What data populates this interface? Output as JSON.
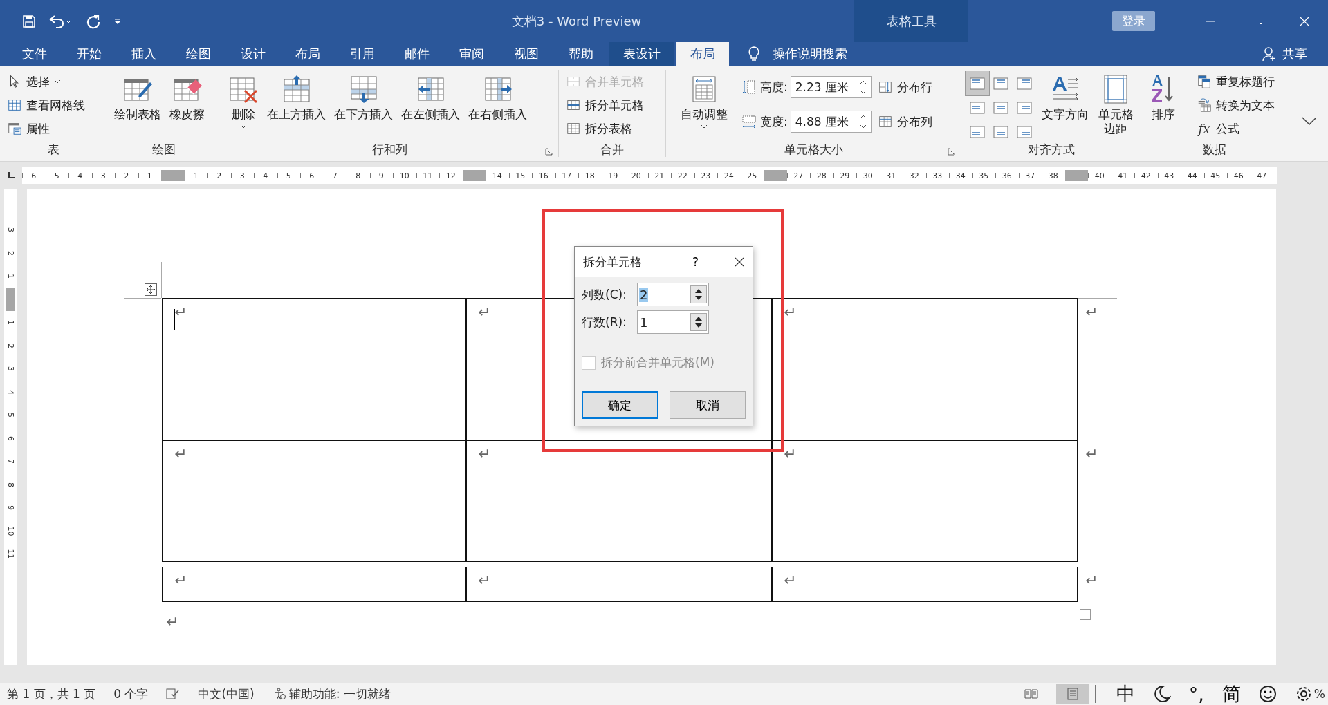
{
  "window": {
    "title": "文档3  -  Word Preview",
    "context_group": "表格工具",
    "signin": "登录"
  },
  "tabs": [
    {
      "label": "文件",
      "selected": false,
      "contextual": false
    },
    {
      "label": "开始",
      "selected": false,
      "contextual": false
    },
    {
      "label": "插入",
      "selected": false,
      "contextual": false
    },
    {
      "label": "绘图",
      "selected": false,
      "contextual": false
    },
    {
      "label": "设计",
      "selected": false,
      "contextual": false
    },
    {
      "label": "布局",
      "selected": false,
      "contextual": false
    },
    {
      "label": "引用",
      "selected": false,
      "contextual": false
    },
    {
      "label": "邮件",
      "selected": false,
      "contextual": false
    },
    {
      "label": "审阅",
      "selected": false,
      "contextual": false
    },
    {
      "label": "视图",
      "selected": false,
      "contextual": false
    },
    {
      "label": "帮助",
      "selected": false,
      "contextual": false
    },
    {
      "label": "表设计",
      "selected": false,
      "contextual": true
    },
    {
      "label": "布局",
      "selected": true,
      "contextual": true
    }
  ],
  "tell_me": "操作说明搜索",
  "share": "共享",
  "ribbon": {
    "groups": [
      {
        "label": "表",
        "launcher": false,
        "items": [
          {
            "kind": "small",
            "label": "选择",
            "dropdown": true
          },
          {
            "kind": "small",
            "label": "查看网格线"
          },
          {
            "kind": "small",
            "label": "属性"
          }
        ]
      },
      {
        "label": "绘图",
        "launcher": false,
        "items": [
          {
            "kind": "large",
            "label": "绘制表格"
          },
          {
            "kind": "large",
            "label": "橡皮擦"
          }
        ]
      },
      {
        "label": "行和列",
        "launcher": true,
        "items": [
          {
            "kind": "large",
            "label": "删除",
            "dropdown": true
          },
          {
            "kind": "large",
            "label": "在上方插入"
          },
          {
            "kind": "large",
            "label": "在下方插入"
          },
          {
            "kind": "large",
            "label": "在左侧插入"
          },
          {
            "kind": "large",
            "label": "在右侧插入"
          }
        ]
      },
      {
        "label": "合并",
        "launcher": false,
        "items": [
          {
            "kind": "small",
            "label": "合并单元格",
            "disabled": true
          },
          {
            "kind": "small",
            "label": "拆分单元格",
            "disabled": false
          },
          {
            "kind": "small",
            "label": "拆分表格",
            "disabled": false
          }
        ]
      },
      {
        "label": "单元格大小",
        "launcher": true,
        "items": [
          {
            "kind": "large",
            "label": "自动调整",
            "dropdown": true
          },
          {
            "kind": "spinner",
            "label": "高度:",
            "value": "2.23 厘米"
          },
          {
            "kind": "spinner",
            "label": "宽度:",
            "value": "4.88 厘米"
          },
          {
            "kind": "small",
            "label": "分布行"
          },
          {
            "kind": "small",
            "label": "分布列"
          }
        ]
      },
      {
        "label": "对齐方式",
        "launcher": false,
        "items": [
          {
            "kind": "align_grid",
            "cells": [
              {
                "selected": true
              },
              {
                "selected": false
              },
              {
                "selected": false
              },
              {
                "selected": false
              },
              {
                "selected": false
              },
              {
                "selected": false
              },
              {
                "selected": false
              },
              {
                "selected": false
              },
              {
                "selected": false
              }
            ]
          },
          {
            "kind": "large",
            "label": "文字方向"
          },
          {
            "kind": "large",
            "label": "单元格边距"
          }
        ]
      },
      {
        "label": "数据",
        "launcher": false,
        "items": [
          {
            "kind": "large",
            "label": "排序"
          },
          {
            "kind": "small",
            "label": "重复标题行"
          },
          {
            "kind": "small",
            "label": "转换为文本"
          },
          {
            "kind": "small",
            "label": "公式",
            "glyph": "fx"
          }
        ]
      }
    ]
  },
  "horizontal_ruler": [
    [
      "6",
      "5",
      "4",
      "3",
      "2",
      "1"
    ],
    [
      "1",
      "2",
      "3",
      "4",
      "5",
      "6",
      "7",
      "8",
      "9",
      "10",
      "11",
      "12"
    ],
    [
      "14",
      "15",
      "16",
      "17",
      "18",
      "19",
      "20",
      "21",
      "22",
      "23",
      "24",
      "25"
    ],
    [
      "27",
      "28",
      "29",
      "30",
      "31",
      "32",
      "33",
      "34",
      "35",
      "36",
      "37",
      "38"
    ],
    [
      "40",
      "41",
      "42",
      "43",
      "44",
      "45",
      "46",
      "47"
    ]
  ],
  "vertical_ruler": [
    [
      "3",
      "2",
      "1"
    ],
    [
      "1",
      "2",
      "3",
      "4",
      "5",
      "6",
      "7",
      "8",
      "9",
      "10",
      "11"
    ]
  ],
  "table": {
    "rows": [
      {
        "cells": [
          "↵",
          "↵",
          "↵"
        ],
        "end_mark": "↵"
      },
      {
        "cells": [
          "↵",
          "↵",
          "↵"
        ],
        "end_mark": "↵"
      },
      {
        "cells": [
          "↵",
          "↵",
          "↵"
        ],
        "end_mark": "↵"
      }
    ],
    "after_mark": "↵"
  },
  "dialog": {
    "title": "拆分单元格",
    "help": "?",
    "fields": [
      {
        "label": "列数(C):",
        "value": "2",
        "selected": true
      },
      {
        "label": "行数(R):",
        "value": "1",
        "selected": false
      }
    ],
    "checkbox": {
      "label": "拆分前合并单元格(M)",
      "checked": false,
      "disabled": true
    },
    "buttons": [
      {
        "label": "确定",
        "default": true
      },
      {
        "label": "取消",
        "default": false
      }
    ]
  },
  "status_bar": {
    "page": "第 1 页，共 1 页",
    "words": "0 个字",
    "language": "中文(中国)",
    "accessibility": "辅助功能: 一切就绪",
    "ime": [
      "中",
      "°,",
      "简"
    ],
    "zoom": "%"
  }
}
